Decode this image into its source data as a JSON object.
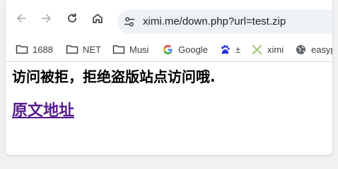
{
  "toolbar": {
    "url": "ximi.me/down.php?url=test.zip"
  },
  "icons": {
    "back": "arrow-left-icon",
    "forward": "arrow-right-icon",
    "reload": "reload-icon",
    "home": "home-icon",
    "site_info": "tune-icon"
  },
  "bookmarks": [
    {
      "label": "1688",
      "icon": "folder-icon"
    },
    {
      "label": "NET",
      "icon": "folder-icon"
    },
    {
      "label": "Musi",
      "icon": "folder-icon"
    },
    {
      "label": "Google",
      "icon": "google-icon"
    },
    {
      "label": "±",
      "icon": "baidu-paw-icon"
    },
    {
      "label": "ximi",
      "icon": "ximi-icon"
    },
    {
      "label": "easyp",
      "icon": "globe-icon"
    }
  ],
  "page": {
    "message": "访问被拒，拒绝盗版站点访问哦.",
    "link_text": "原文地址"
  },
  "colors": {
    "link": "#551a8b",
    "omnibox_bg": "#eef1f6"
  }
}
